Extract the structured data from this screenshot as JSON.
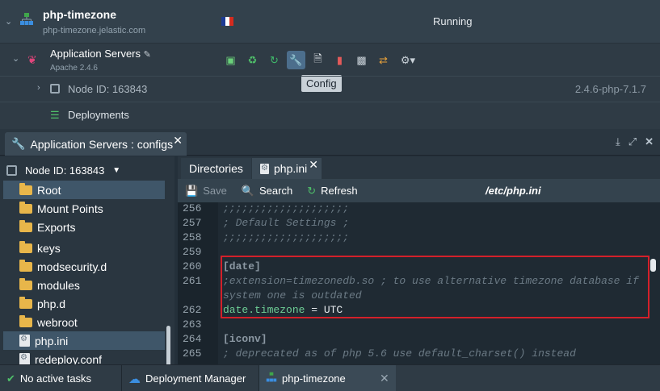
{
  "environment": {
    "name": "php-timezone",
    "domain": "php-timezone.jelastic.com",
    "status": "Running",
    "flag": [
      "#1d3b95",
      "#ffffff",
      "#d52b1e"
    ]
  },
  "app_servers": {
    "name": "Application Servers",
    "version": "Apache 2.4.6",
    "tooltip": "Config",
    "tools": [
      "add-node-icon",
      "redeploy-icon",
      "restart-icon",
      "config-icon",
      "log-icon",
      "statistics-icon",
      "web-ssh-icon",
      "refresh-icon",
      "settings-icon"
    ]
  },
  "node": {
    "label": "Node ID: 163843",
    "version": "2.4.6-php-7.1.7"
  },
  "deployments": {
    "label": "Deployments"
  },
  "config_window": {
    "title": "Application Servers : configs",
    "node_selector": "Node ID: 163843",
    "tree": [
      {
        "label": "Root",
        "icon": "folder",
        "selected": true
      },
      {
        "label": "Mount Points",
        "icon": "folder"
      },
      {
        "label": "Exports",
        "icon": "folder"
      },
      {
        "label": "keys",
        "icon": "folder"
      },
      {
        "label": "modsecurity.d",
        "icon": "folder"
      },
      {
        "label": "modules",
        "icon": "folder"
      },
      {
        "label": "php.d",
        "icon": "folder"
      },
      {
        "label": "webroot",
        "icon": "folder"
      },
      {
        "label": "php.ini",
        "icon": "file",
        "selected": true
      },
      {
        "label": "redeploy.conf",
        "icon": "file"
      }
    ],
    "tabs": {
      "directories": "Directories",
      "file": "php.ini"
    },
    "toolbar": {
      "save": "Save",
      "search": "Search",
      "refresh": "Refresh",
      "path": "/etc/php.ini"
    },
    "code": [
      {
        "n": "256",
        "text": ";;;;;;;;;;;;;;;;;;;;",
        "kind": "cm"
      },
      {
        "n": "257",
        "text": "; Default Settings ;",
        "kind": "cm"
      },
      {
        "n": "258",
        "text": ";;;;;;;;;;;;;;;;;;;;",
        "kind": "cm"
      },
      {
        "n": "259",
        "text": "",
        "kind": "cm"
      },
      {
        "n": "260",
        "text": "[date]",
        "kind": "sec"
      },
      {
        "n": "261",
        "text": ";extension=timezonedb.so ; to use alternative timezone database if",
        "kind": "cm"
      },
      {
        "n": "",
        "text": "system one is outdated",
        "kind": "cm"
      },
      {
        "n": "262",
        "key": "date.timezone",
        "op": " = ",
        "val": "UTC",
        "kind": "kv"
      },
      {
        "n": "263",
        "text": "",
        "kind": "cm"
      },
      {
        "n": "264",
        "text": "[iconv]",
        "kind": "sec"
      },
      {
        "n": "265",
        "text": "; deprecated as of php 5.6 use default_charset() instead",
        "kind": "cm"
      }
    ]
  },
  "taskbar": {
    "tasks": "No active tasks",
    "deployment_manager": "Deployment Manager",
    "env_tab": "php-timezone"
  }
}
